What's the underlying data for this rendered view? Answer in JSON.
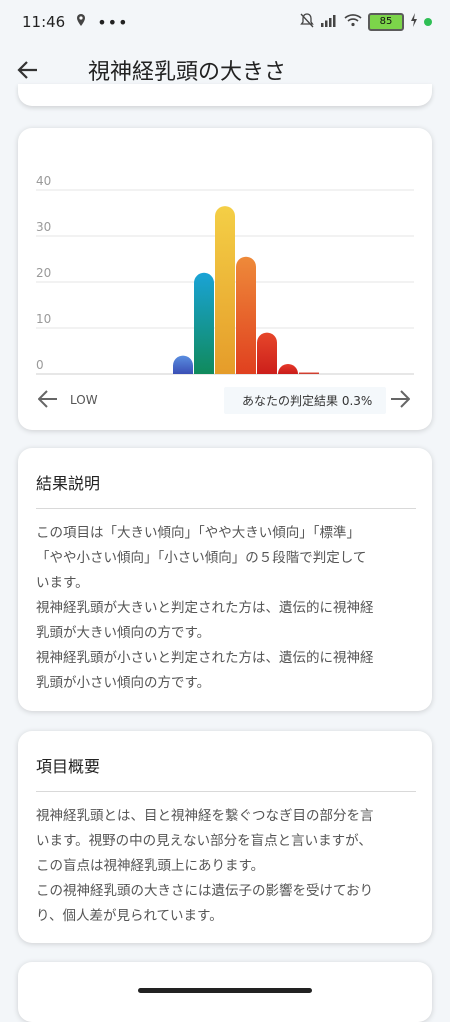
{
  "status_bar": {
    "time": "11:46",
    "battery": "85",
    "icons": [
      "location-icon",
      "more-dots-icon",
      "mute-bell-icon",
      "signal-icon",
      "wifi-icon",
      "battery-icon",
      "charging-icon",
      "notification-dot-icon"
    ]
  },
  "app_bar": {
    "back_icon": "arrow-left-icon",
    "title": "視神経乳頭の大きさ"
  },
  "chart": {
    "low_label": "LOW",
    "verdict_text": "あなたの判定結果 0.3%",
    "prev_icon": "arrow-left-icon",
    "next_icon": "arrow-right-icon"
  },
  "chart_data": {
    "type": "bar",
    "yticks": [
      "40",
      "30",
      "20",
      "10",
      "0"
    ],
    "ylim": [
      0,
      40
    ],
    "grid": true,
    "values": [
      4,
      22,
      36.5,
      25.5,
      9,
      2,
      0.3
    ],
    "colors": [
      [
        "#5a8ee0",
        "#3a4fb5"
      ],
      [
        "#1aa3d6",
        "#108a5c"
      ],
      [
        "#f4cf46",
        "#e59c2a"
      ],
      [
        "#ee8a3a",
        "#e0401f"
      ],
      [
        "#e6462a",
        "#cc1f1b"
      ],
      [
        "#e6392a",
        "#c81c1a"
      ],
      [
        "#e74c3c",
        "#c0392b"
      ]
    ]
  },
  "result_card": {
    "title": "結果説明",
    "lines": [
      "この項目は「大きい傾向」「やや大きい傾向」「標準」",
      "「やや小さい傾向」「小さい傾向」の５段階で判定して",
      "います。",
      "視神経乳頭が大きいと判定された方は、遺伝的に視神経",
      "乳頭が大きい傾向の方です。",
      "視神経乳頭が小さいと判定された方は、遺伝的に視神経",
      "乳頭が小さい傾向の方です。"
    ]
  },
  "overview_card": {
    "title": "項目概要",
    "lines": [
      "視神経乳頭とは、目と視神経を繋ぐつなぎ目の部分を言",
      "います。視野の中の見えない部分を盲点と言いますが、",
      "この盲点は視神経乳頭上にあります。",
      "この視神経乳頭の大きさには遺伝子の影響を受けており",
      "り、個人差が見られています。"
    ]
  }
}
